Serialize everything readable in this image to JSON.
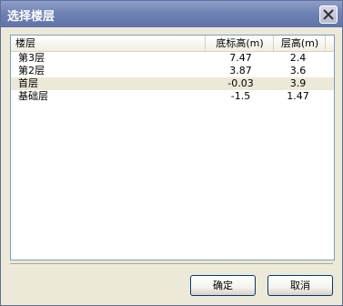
{
  "window": {
    "title": "选择楼层"
  },
  "table": {
    "columns": [
      "楼层",
      "底标高(m)",
      "层高(m)"
    ],
    "rows": [
      {
        "floor": "第3层",
        "base_elevation": "7.47",
        "height": "2.4"
      },
      {
        "floor": "第2层",
        "base_elevation": "3.87",
        "height": "3.6"
      },
      {
        "floor": "首层",
        "base_elevation": "-0.03",
        "height": "3.9"
      },
      {
        "floor": "基础层",
        "base_elevation": "-1.5",
        "height": "1.47"
      }
    ],
    "selected_row": 2
  },
  "buttons": {
    "ok_label": "确定",
    "cancel_label": "取消"
  },
  "icons": {
    "close": "close-icon"
  }
}
